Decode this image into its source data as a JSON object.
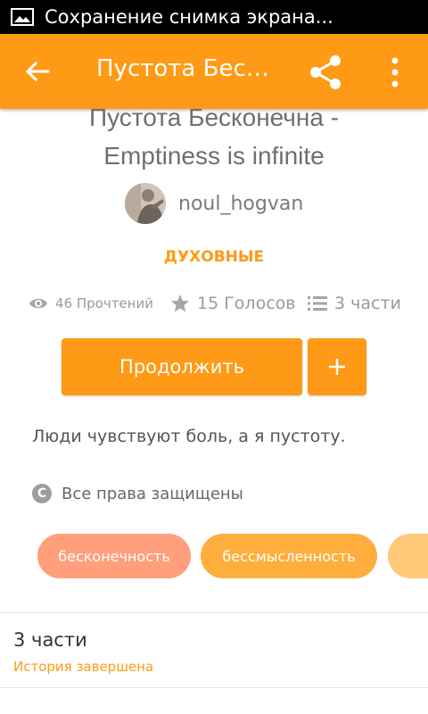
{
  "status_bar": {
    "notification_text": "Сохранение снимка экрана..."
  },
  "app_bar": {
    "title": "Пустота Бесконечна",
    "icons": [
      "back-arrow-icon",
      "share-icon",
      "more-vert-icon"
    ]
  },
  "story": {
    "title_line1": "Пустота Бесконечна -",
    "title_line2": "Emptiness is infinite",
    "author": "noul_hogvan",
    "category": "ДУХОВНЫЕ",
    "reads": "46 Прочтений",
    "votes": "15 Голосов",
    "parts": "3 части",
    "description": "Люди чувствуют боль, а я пустоту.",
    "rights": "Все права защищены",
    "copyright_symbol": "C"
  },
  "actions": {
    "continue_label": "Продолжить"
  },
  "tags": [
    "бесконечность",
    "бессмысленность"
  ],
  "parts_section": {
    "title": "3 части",
    "status": "История завершена"
  },
  "colors": {
    "accent": "#ff9a16",
    "tag1": "#ff9f7c",
    "tag2": "#ffae3d",
    "tag3": "#ffc97a"
  }
}
